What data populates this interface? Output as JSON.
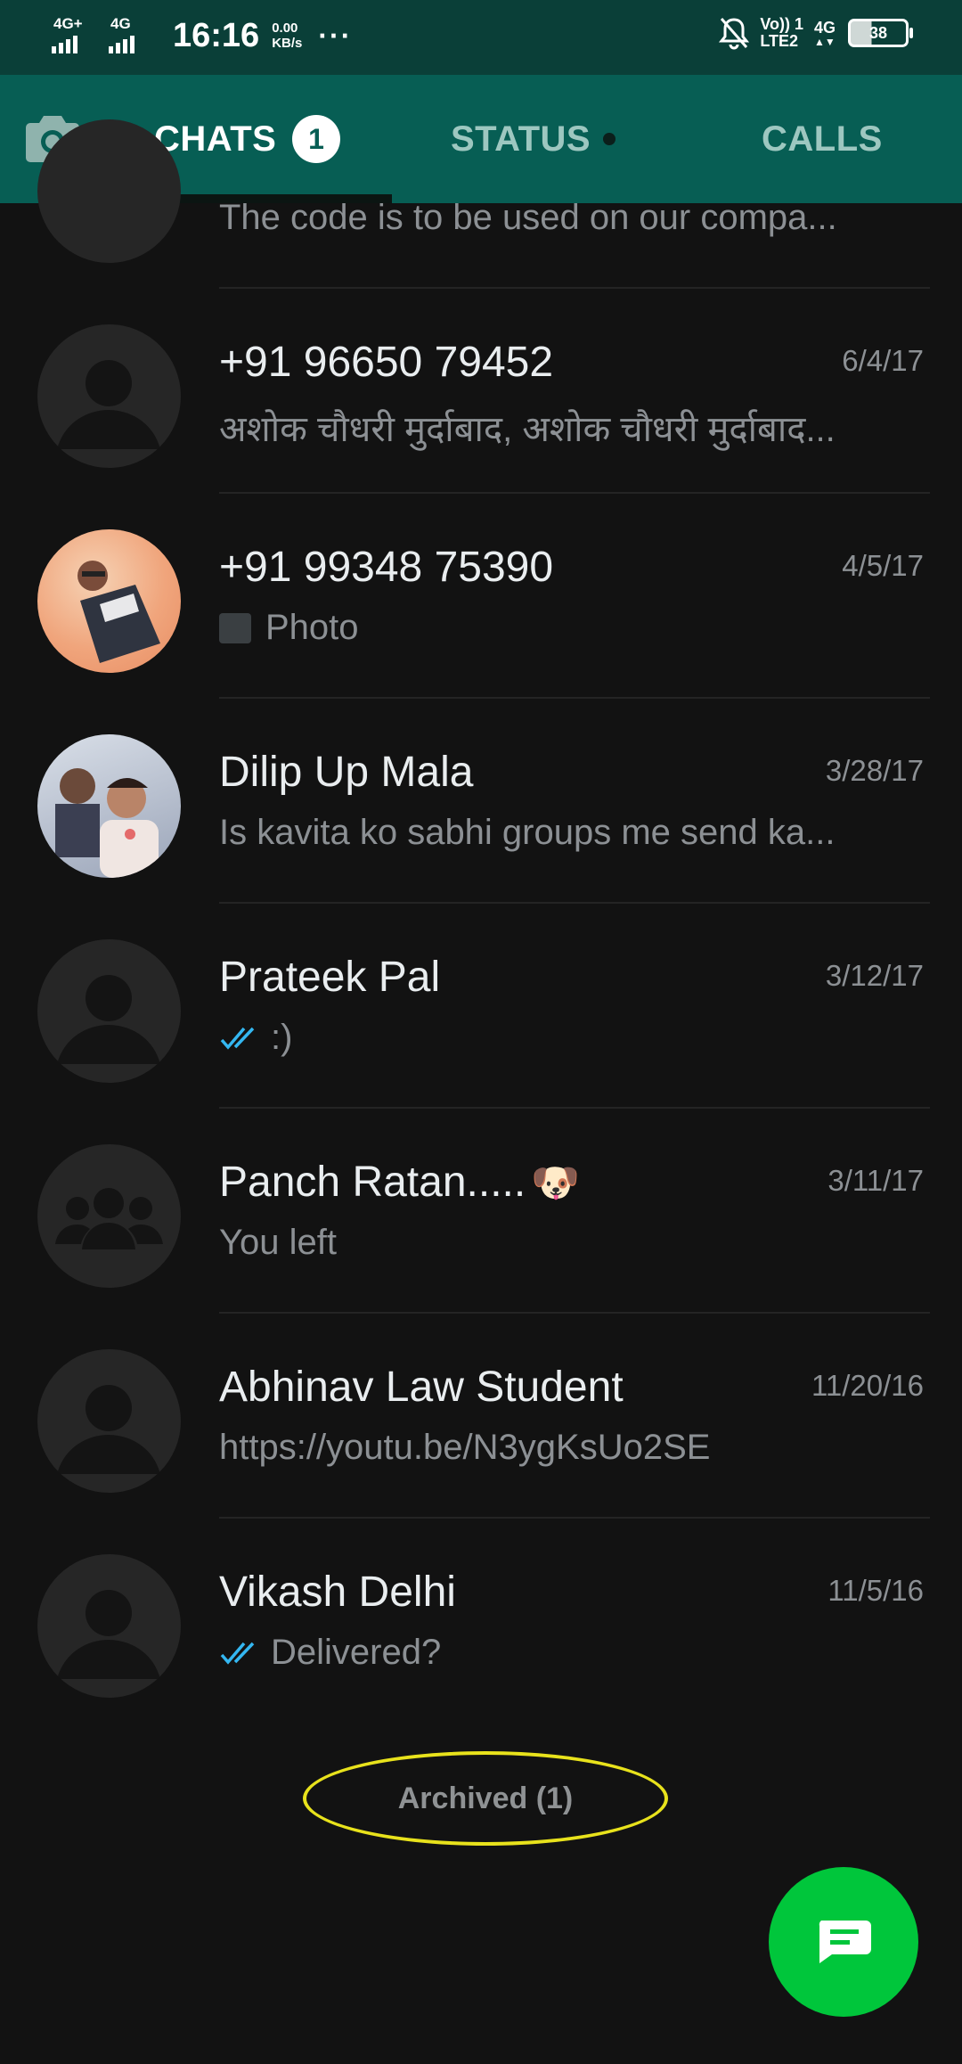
{
  "status_bar": {
    "sim1_label": "4G+",
    "sim2_label": "4G",
    "time": "16:16",
    "speed_value": "0.00",
    "speed_unit": "KB/s",
    "more": "···",
    "volte_line1": "Vo)) 1",
    "volte_line2": "LTE2",
    "net_label": "4G",
    "battery": "38"
  },
  "tabs": {
    "chats": "CHATS",
    "chats_badge": "1",
    "status": "STATUS",
    "calls": "CALLS"
  },
  "partial_chat": {
    "preview": "The code is to be used on our compa..."
  },
  "chats": [
    {
      "name": "+91 96650 79452",
      "date": "6/4/17",
      "preview": "अशोक चौधरी मुर्दाबाद, अशोक चौधरी मुर्दाबाद..."
    },
    {
      "name": "+91 99348 75390",
      "date": "4/5/17",
      "preview": "Photo"
    },
    {
      "name": "Dilip Up Mala",
      "date": "3/28/17",
      "preview": "Is kavita ko sabhi groups me send ka..."
    },
    {
      "name": "Prateek Pal",
      "date": "3/12/17",
      "preview": ":)"
    },
    {
      "name": "Panch Ratan.....",
      "date": "3/11/17",
      "preview": "You left",
      "emoji": "🐶"
    },
    {
      "name": "Abhinav Law Student",
      "date": "11/20/16",
      "preview": "https://youtu.be/N3ygKsUo2SE"
    },
    {
      "name": "Vikash Delhi",
      "date": "11/5/16",
      "preview": "Delivered?"
    }
  ],
  "archived": "Archived (1)",
  "colors": {
    "header": "#075e54",
    "statusbar": "#0a3f38",
    "background": "#121212",
    "fab": "#00c63b",
    "read_ticks": "#34b7f1",
    "highlight": "#e8e21c"
  }
}
